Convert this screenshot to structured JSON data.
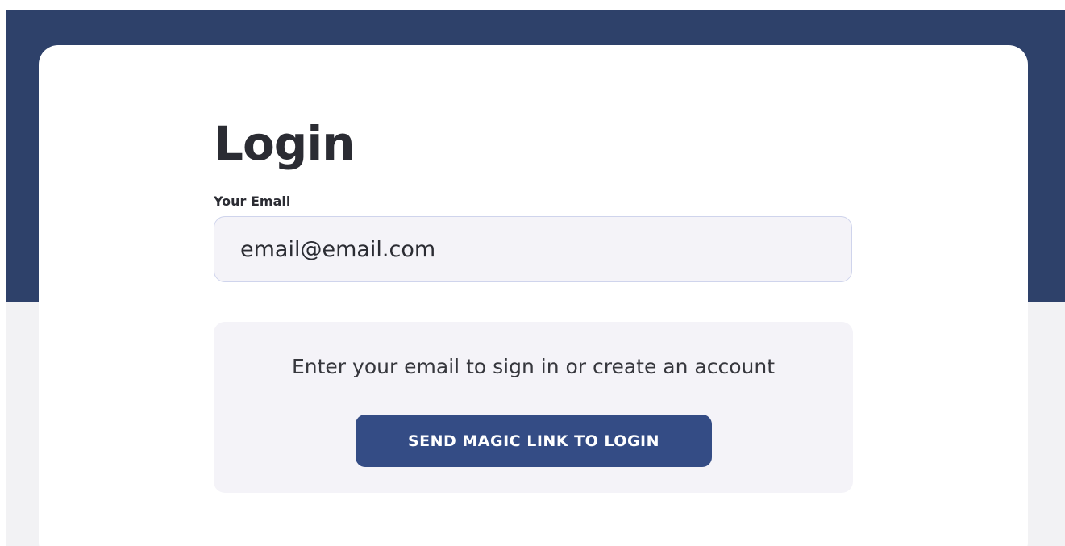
{
  "login": {
    "title": "Login",
    "email_label": "Your Email",
    "email_value": "email@email.com",
    "info_text": "Enter your email to sign in or create an account",
    "button_label": "SEND MAGIC LINK TO LOGIN"
  },
  "colors": {
    "header_background": "#2e416a",
    "page_background": "#f2f2f4",
    "card_background": "#ffffff",
    "input_background": "#f4f3f8",
    "input_border": "#cfd4ec",
    "button_background": "#344c85",
    "button_text": "#ffffff",
    "text": "#2b2c33"
  }
}
